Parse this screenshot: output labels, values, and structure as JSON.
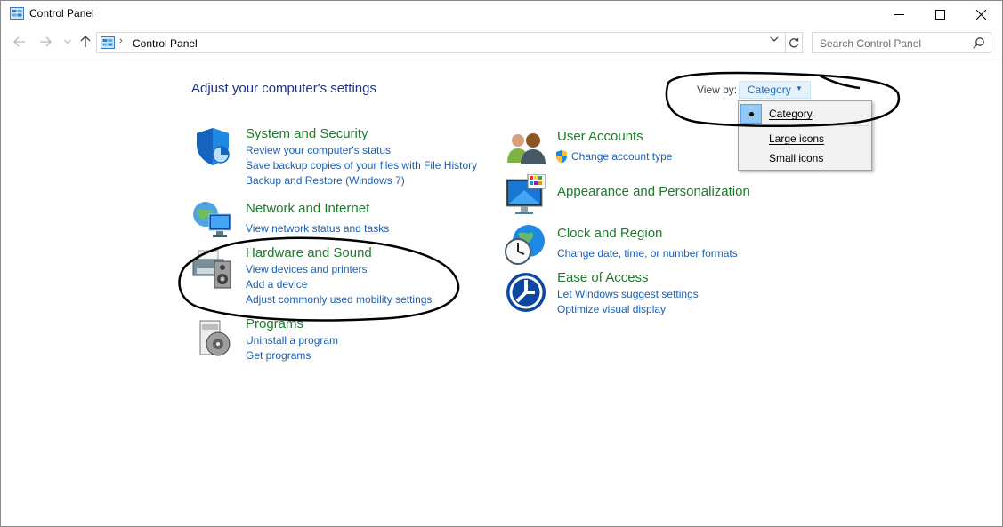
{
  "window": {
    "title": "Control Panel"
  },
  "address": {
    "path": "Control Panel",
    "search_placeholder": "Search Control Panel"
  },
  "content": {
    "heading": "Adjust your computer's settings",
    "view_by_label": "View by:",
    "view_by_value": "Category",
    "view_options": [
      "Category",
      "Large icons",
      "Small icons"
    ]
  },
  "categories": [
    {
      "title": "System and Security",
      "icon": "shield-icon",
      "links": [
        "Review your computer's status",
        "Save backup copies of your files with File History",
        "Backup and Restore (Windows 7)"
      ]
    },
    {
      "title": "Network and Internet",
      "icon": "globe-network-icon",
      "links": [
        "View network status and tasks"
      ]
    },
    {
      "title": "Hardware and Sound",
      "icon": "printer-speaker-icon",
      "links": [
        "View devices and printers",
        "Add a device",
        "Adjust commonly used mobility settings"
      ]
    },
    {
      "title": "Programs",
      "icon": "programs-disc-icon",
      "links": [
        "Uninstall a program",
        "Get programs"
      ]
    },
    {
      "title": "User Accounts",
      "icon": "users-icon",
      "links": [
        "Change account type"
      ]
    },
    {
      "title": "Appearance and Personalization",
      "icon": "monitor-palette-icon",
      "links": []
    },
    {
      "title": "Clock and Region",
      "icon": "clock-globe-icon",
      "links": [
        "Change date, time, or number formats"
      ]
    },
    {
      "title": "Ease of Access",
      "icon": "ease-of-access-icon",
      "links": [
        "Let Windows suggest settings",
        "Optimize visual display"
      ]
    }
  ],
  "colors": {
    "heading": "#1e3287",
    "category_title": "#1e7b2c",
    "link": "#1a5fb4",
    "annotation": "#000000"
  }
}
